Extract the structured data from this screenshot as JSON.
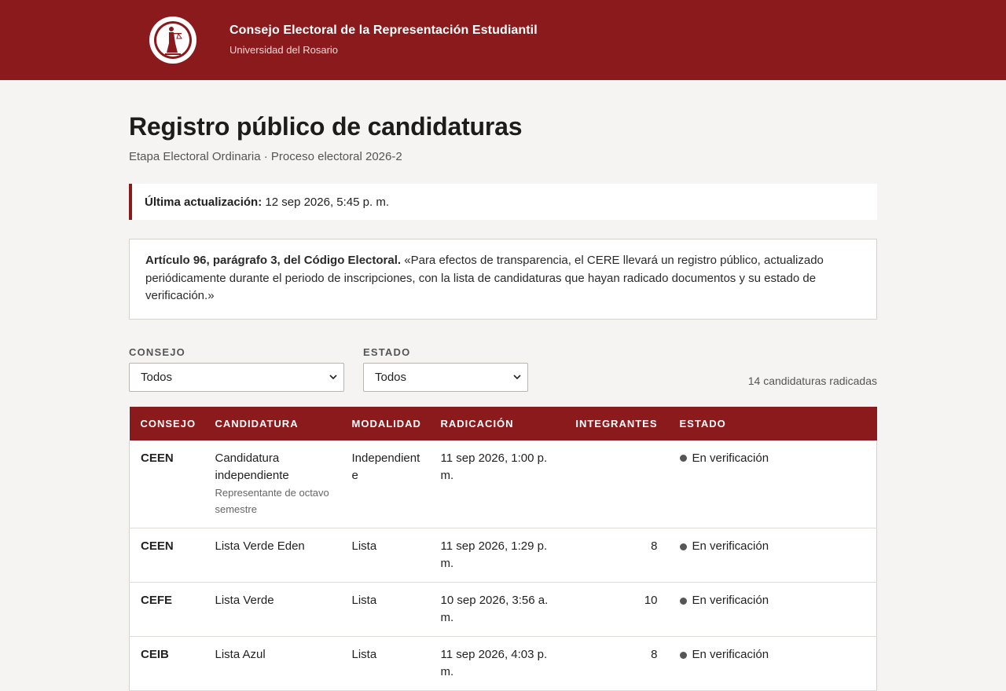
{
  "header": {
    "title": "Consejo Electoral de la Representación Estudiantil",
    "subtitle": "Universidad del Rosario",
    "logo_icon": "justice-seal-icon",
    "brand_color": "#8b1a1c"
  },
  "page": {
    "title": "Registro público de candidaturas",
    "subtitle": "Etapa Electoral Ordinaria · Proceso electoral 2026-2"
  },
  "updated": {
    "label": "Última actualización:",
    "value": "12 sep 2026, 5:45 p. m."
  },
  "article": {
    "ref": "Artículo 96, parágrafo 3, del Código Electoral.",
    "text": "«Para efectos de transparencia, el CERE llevará un registro público, actualizado periódicamente durante el periodo de inscripciones, con la lista de candidaturas que hayan radicado documentos y su estado de verificación.»"
  },
  "filters": {
    "consejo_label": "CONSEJO",
    "consejo_value": "Todos",
    "estado_label": "ESTADO",
    "estado_value": "Todos",
    "count": "14 candidaturas radicadas"
  },
  "table": {
    "headers": [
      "CONSEJO",
      "CANDIDATURA",
      "MODALIDAD",
      "RADICACIÓN",
      "INTEGRANTES",
      "ESTADO"
    ],
    "rows": [
      {
        "consejo": "CEEN",
        "candidatura": "Candidatura independiente",
        "nota": "Representante de octavo semestre",
        "modalidad": "Independiente",
        "radicacion": "11 sep 2026, 1:00 p. m.",
        "integrantes": "",
        "estado": "En verificación"
      },
      {
        "consejo": "CEEN",
        "candidatura": "Lista Verde Eden",
        "nota": "",
        "modalidad": "Lista",
        "radicacion": "11 sep 2026, 1:29 p. m.",
        "integrantes": "8",
        "estado": "En verificación"
      },
      {
        "consejo": "CEFE",
        "candidatura": "Lista Verde",
        "nota": "",
        "modalidad": "Lista",
        "radicacion": "10 sep 2026, 3:56 a. m.",
        "integrantes": "10",
        "estado": "En verificación"
      },
      {
        "consejo": "CEIB",
        "candidatura": "Lista Azul",
        "nota": "",
        "modalidad": "Lista",
        "radicacion": "11 sep 2026, 4:03 p. m.",
        "integrantes": "8",
        "estado": "En verificación"
      }
    ]
  }
}
